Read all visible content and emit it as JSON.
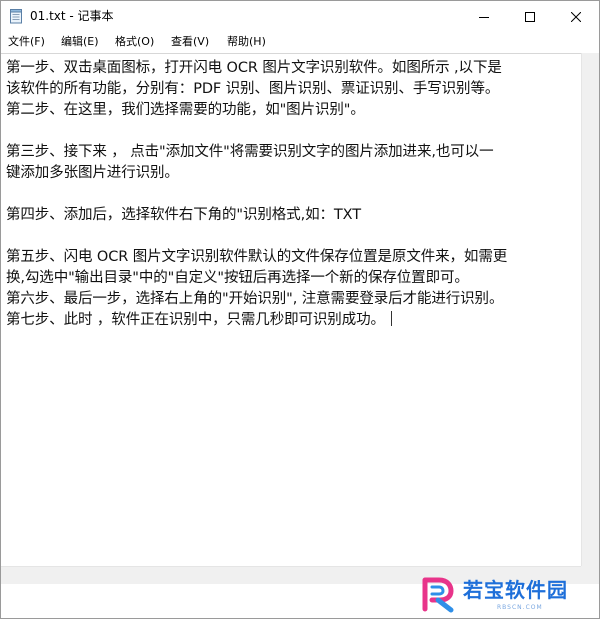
{
  "window": {
    "title": "01.txt - 记事本",
    "icon": "notepad-icon",
    "controls": [
      "minimize-icon",
      "maximize-icon",
      "close-icon"
    ]
  },
  "menu": [
    {
      "label": "文件(F)"
    },
    {
      "label": "编辑(E)"
    },
    {
      "label": "格式(O)"
    },
    {
      "label": "查看(V)"
    },
    {
      "label": "帮助(H)"
    }
  ],
  "document": {
    "lines": [
      "第一步、双击桌面图标，打开闪电 OCR 图片文字识别软件。如图所示 ,以下是",
      "该软件的所有功能，分别有：PDF 识别、图片识别、票证识别、手写识别等。",
      "第二步、在这里，我们选择需要的功能，如\"图片识别\"。",
      "",
      "第三步、接下来 ， 点击\"添加文件\"将需要识别文字的图片添加进来,也可以一",
      "键添加多张图片进行识别。",
      "",
      "第四步、添加后，选择软件右下角的\"识别格式,如：TXT",
      "",
      "第五步、闪电 OCR 图片文字识别软件默认的文件保存位置是原文件来，如需更",
      "换,勾选中\"输出目录\"中的\"自定义\"按钮后再选择一个新的保存位置即可。",
      "第六步、最后一步，选择右上角的\"开始识别\", 注意需要登录后才能进行识别。",
      "第七步、此时 ，软件正在识别中，只需几秒即可识别成功。"
    ]
  },
  "watermark": {
    "text": "若宝软件园",
    "url": "RBSCN.COM",
    "accent": "#1e6fd9",
    "logo_colors": [
      "#e8348a",
      "#2f8fe8"
    ]
  }
}
